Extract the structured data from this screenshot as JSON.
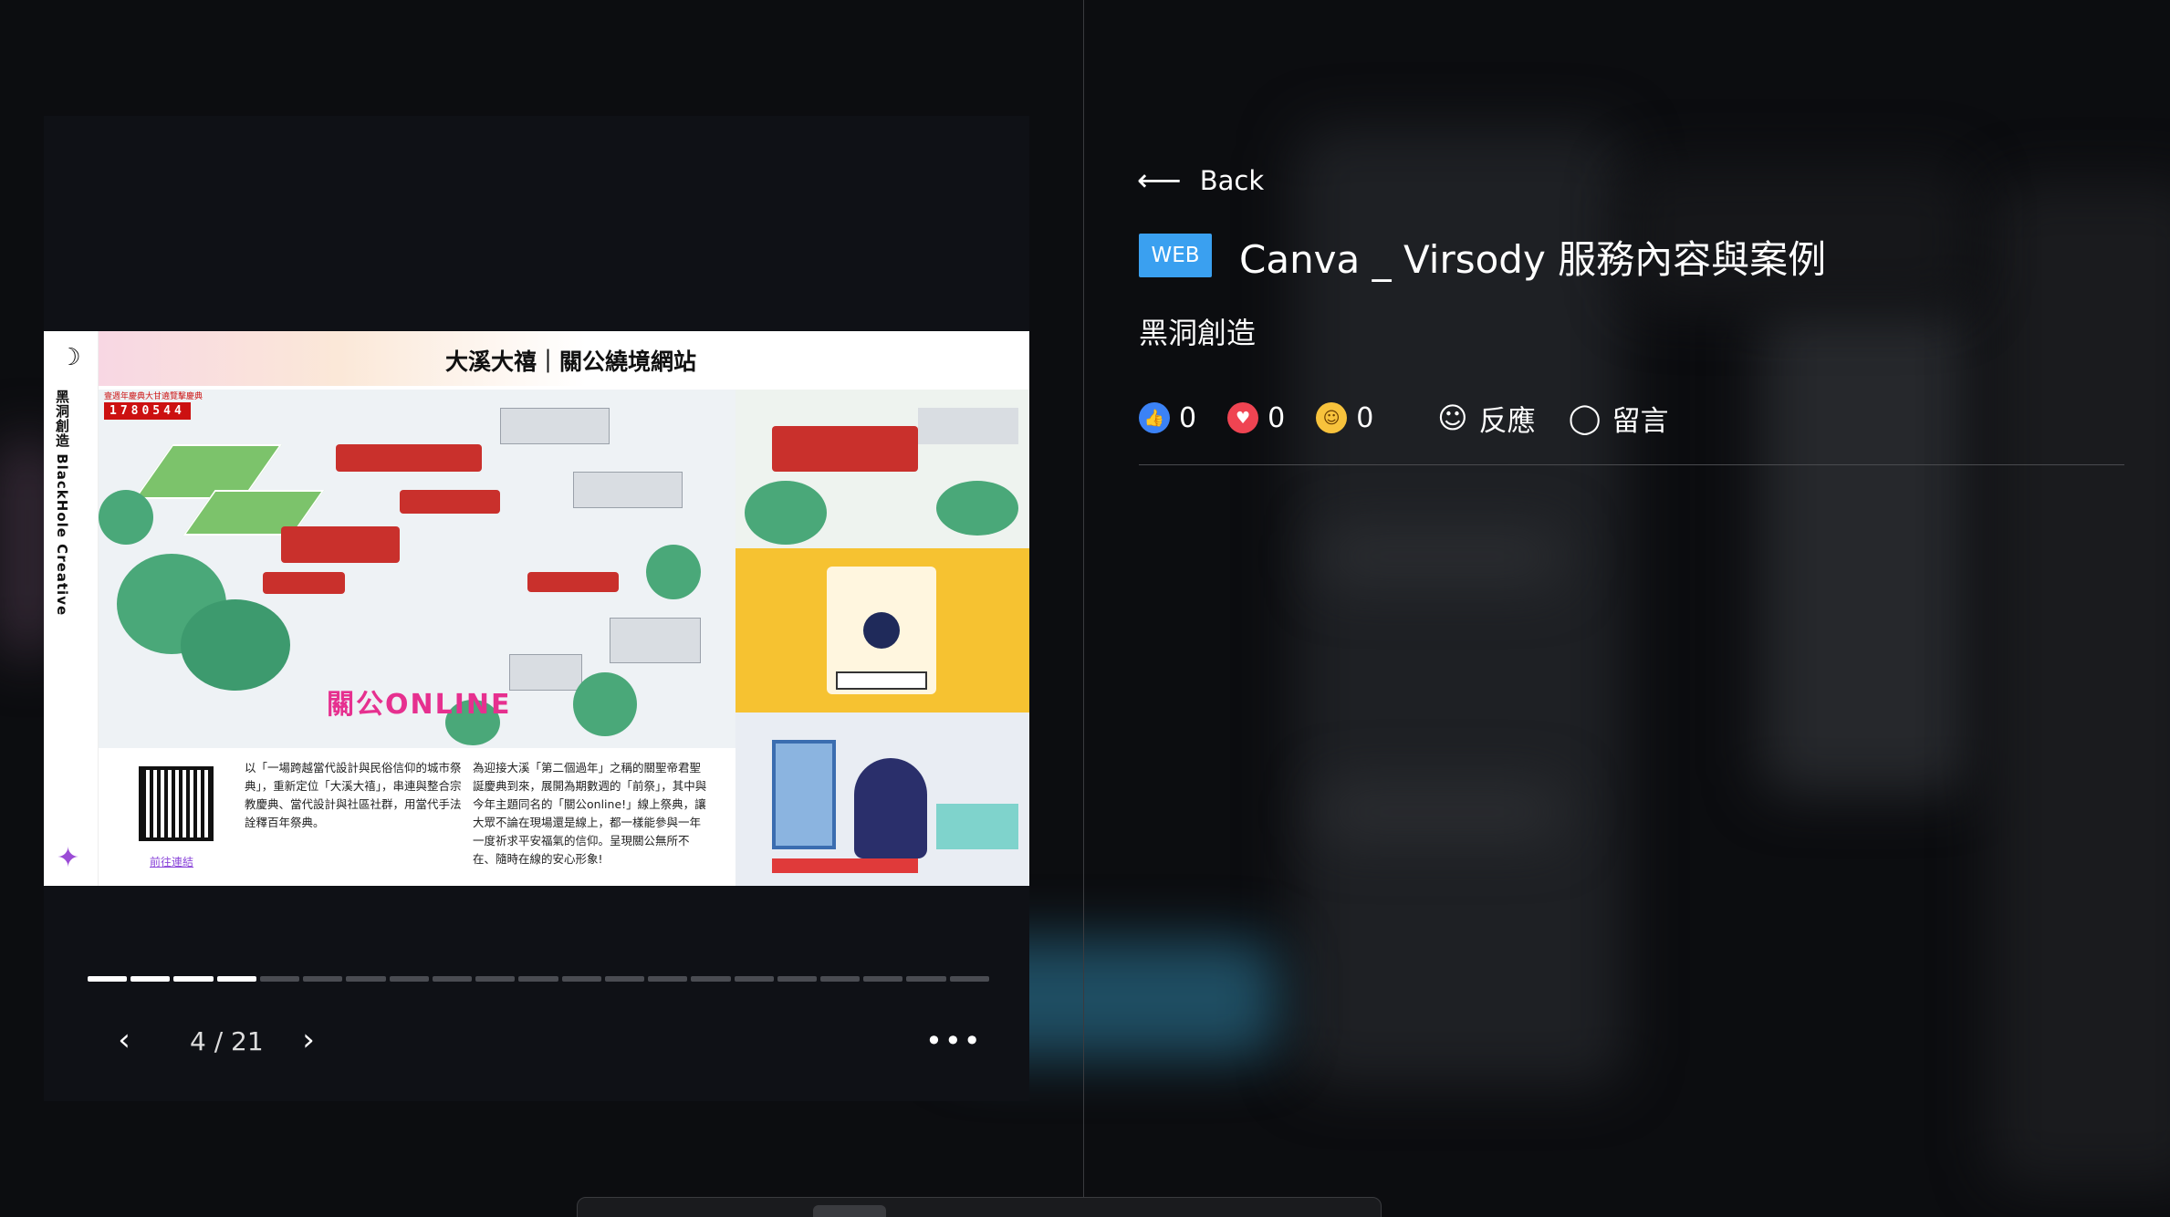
{
  "viewer": {
    "slide": {
      "title": "大溪大禧｜關公繞境網站",
      "side_text": "黑洞創造 BlackHole Creative",
      "counter_caption": "壹週年慶典大甘遶覽擊慶典",
      "counter": "1780544",
      "online_logo": "關公ONLINE",
      "paragraph_1": "以「一場跨越當代設計與民俗信仰的城市祭典」，重新定位「大溪大禧」，串連與整合宗教慶典、當代設計與社區社群，用當代手法詮釋百年祭典。",
      "paragraph_2": "為迎接大溪「第二個過年」之稱的關聖帝君聖誕慶典到來，展開為期數週的「前祭」，其中與今年主題同名的「關公online!」線上祭典，讓大眾不論在現場還是線上，都一樣能參與一年一度祈求平安福氣的信仰。呈現關公無所不在、隨時在線的安心形象!",
      "qr_link": "前往連結"
    },
    "progress": {
      "current": 4,
      "total": 21
    },
    "page_label": "4 / 21",
    "prev_icon": "chevron-left-icon",
    "next_icon": "chevron-right-icon",
    "more_icon": "more-horizontal-icon"
  },
  "panel": {
    "back_label": "Back",
    "badge": "WEB",
    "title": "Canva _ Virsody 服務內容與案例",
    "author": "黑洞創造",
    "reactions": [
      {
        "icon": "thumbs-up-icon",
        "count": "0"
      },
      {
        "icon": "heart-icon",
        "count": "0"
      },
      {
        "icon": "laugh-emoji-icon",
        "count": "0"
      }
    ],
    "react_label": "反應",
    "comment_label": "留言"
  },
  "colors": {
    "background": "#0c0d10",
    "badge": "#3aa0f0",
    "progress_done": "#ffffff",
    "progress_todo": "#4a4c52"
  }
}
